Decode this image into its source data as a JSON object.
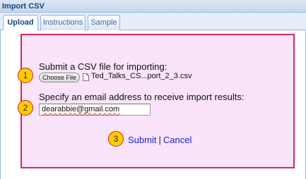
{
  "window": {
    "title": "Import CSV"
  },
  "tabs": [
    {
      "label": "Upload",
      "active": true
    },
    {
      "label": "Instructions",
      "active": false
    },
    {
      "label": "Sample",
      "active": false
    }
  ],
  "form": {
    "file": {
      "step": "1",
      "prompt": "Submit a CSV file for importing:",
      "button_label": "Choose File",
      "file_name": "Ted_Talks_CS...port_2_3.csv"
    },
    "email": {
      "step": "2",
      "prompt": "Specify an email address to receive import results:",
      "value": "dearabbie@gmail.com"
    },
    "actions": {
      "step": "3",
      "submit_label": "Submit",
      "separator": "|",
      "cancel_label": "Cancel"
    }
  },
  "colors": {
    "frame_border": "#d6285e",
    "frame_fill": "#f9e4f9",
    "badge_fill": "#ffcc00",
    "link": "#1a22cc",
    "title_text": "#15428b"
  }
}
